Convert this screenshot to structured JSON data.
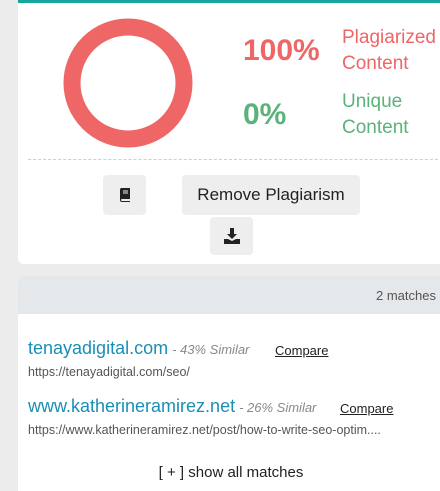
{
  "result": {
    "plagiarized_percent": "100%",
    "plagiarized_label": "Plagiarized Content",
    "unique_percent": "0%",
    "unique_label": "Unique Content",
    "ring_fill_fraction": 1.0,
    "plagiarized_color": "#ee6666",
    "unique_color": "#5bb27a"
  },
  "actions": {
    "book_icon": "book-icon",
    "remove_label": "Remove Plagiarism",
    "download_icon": "download-icon"
  },
  "matches": {
    "count_label": "2 matches",
    "items": [
      {
        "site": "tenayadigital.com",
        "similarity": "- 43% Similar",
        "compare": "Compare",
        "url": "https://tenayadigital.com/seo/"
      },
      {
        "site": "www.katherineramirez.net",
        "similarity": "- 26% Similar",
        "compare": "Compare",
        "url": "https://www.katherineramirez.net/post/how-to-write-seo-optim...."
      }
    ],
    "show_all": "[ + ] show all matches"
  }
}
